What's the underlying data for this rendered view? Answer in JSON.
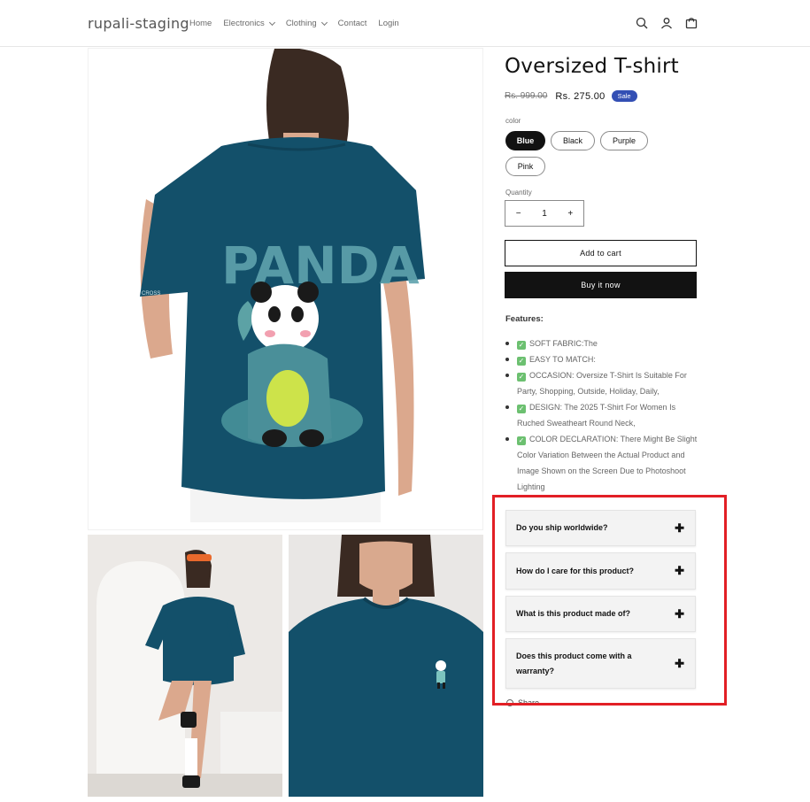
{
  "header": {
    "logo": "rupali-staging",
    "nav": [
      {
        "label": "Home",
        "has_dropdown": false
      },
      {
        "label": "Electronics",
        "has_dropdown": true
      },
      {
        "label": "Clothing",
        "has_dropdown": true
      },
      {
        "label": "Contact",
        "has_dropdown": false
      },
      {
        "label": "Login",
        "has_dropdown": false
      }
    ],
    "icons": [
      "search-icon",
      "account-icon",
      "cart-icon"
    ]
  },
  "product": {
    "title": "Oversized T-shirt",
    "price_old": "Rs. 999.00",
    "price_new": "Rs. 275.00",
    "badge": "Sale",
    "color_label": "color",
    "colors": [
      "Blue",
      "Black",
      "Purple",
      "Pink"
    ],
    "selected_color": "Blue",
    "quantity_label": "Quantity",
    "quantity": "1",
    "add_to_cart": "Add to cart",
    "buy_now": "Buy it now",
    "features_title": "Features:",
    "features": [
      "SOFT FABRIC:The",
      "EASY TO MATCH:",
      "OCCASION: Oversize T-Shirt Is Suitable For Party, Shopping, Outside, Holiday, Daily,",
      "DESIGN: The 2025 T-Shirt For Women Is Ruched Sweatheart Round Neck,",
      "COLOR DECLARATION: There Might Be Slight Color Variation Between the Actual Product and Image Shown on the Screen Due to Photoshoot Lighting"
    ],
    "print_text": "PANDA"
  },
  "faq": [
    "Do you ship worldwide?",
    "How do I care for this product?",
    "What is this product made of?",
    "Does this product come with a warranty?"
  ],
  "share_label": "Share",
  "colors": {
    "shirt": "#13506a",
    "sale_badge": "#334fb4",
    "highlight": "#e21f25",
    "button_dark": "#121212"
  }
}
